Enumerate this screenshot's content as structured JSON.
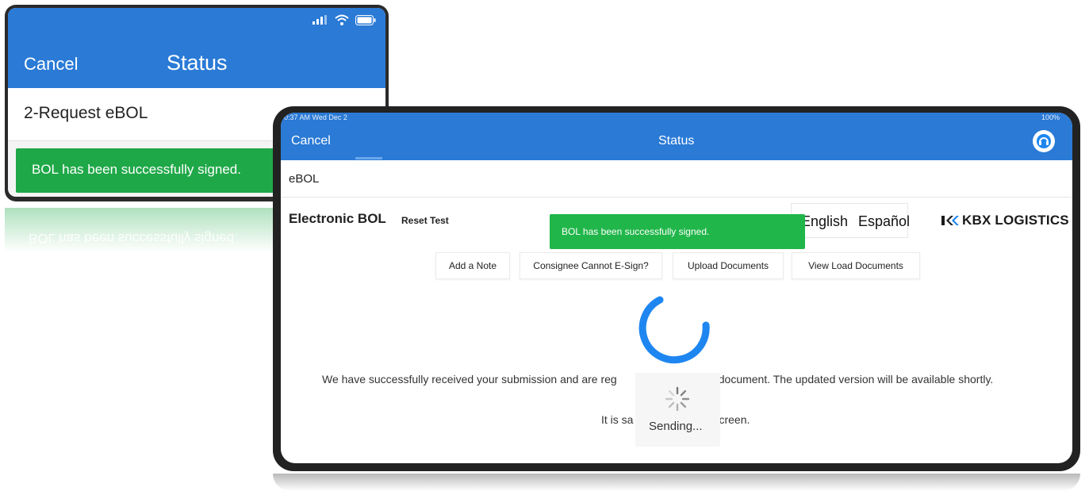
{
  "phone": {
    "nav": {
      "cancel_label": "Cancel",
      "title": "Status"
    },
    "request_row": "2-Request eBOL",
    "toast": "BOL has been successfully signed.",
    "reflection_text": "BOL has been successfully signed."
  },
  "tablet": {
    "statusbar": {
      "time": "0:37 AM  Wed Dec 2",
      "battery": "100%"
    },
    "nav": {
      "cancel_label": "Cancel",
      "title": "Status"
    },
    "ebol_row": "eBOL",
    "section_title": "Electronic BOL",
    "reset_label": "Reset Test",
    "languages": {
      "english": "English",
      "spanish": "Español"
    },
    "logo_text": "KBX LOGISTICS",
    "toast": "BOL has been successfully signed.",
    "buttons": {
      "add_note": "Add a Note",
      "consignee": "Consignee Cannot E-Sign?",
      "upload": "Upload Documents",
      "view_load": "View Load Documents"
    },
    "message_line1_a": "We have successfully received your submission and are reg",
    "message_line1_b": "OL document. The updated version will be available shortly.",
    "message_line2_a": "It is sa",
    "message_line2_b": "creen.",
    "sending_label": "Sending..."
  },
  "colors": {
    "header_blue": "#2a7ad6",
    "success_green": "#21b64a",
    "spinner_blue": "#1e86f0"
  }
}
